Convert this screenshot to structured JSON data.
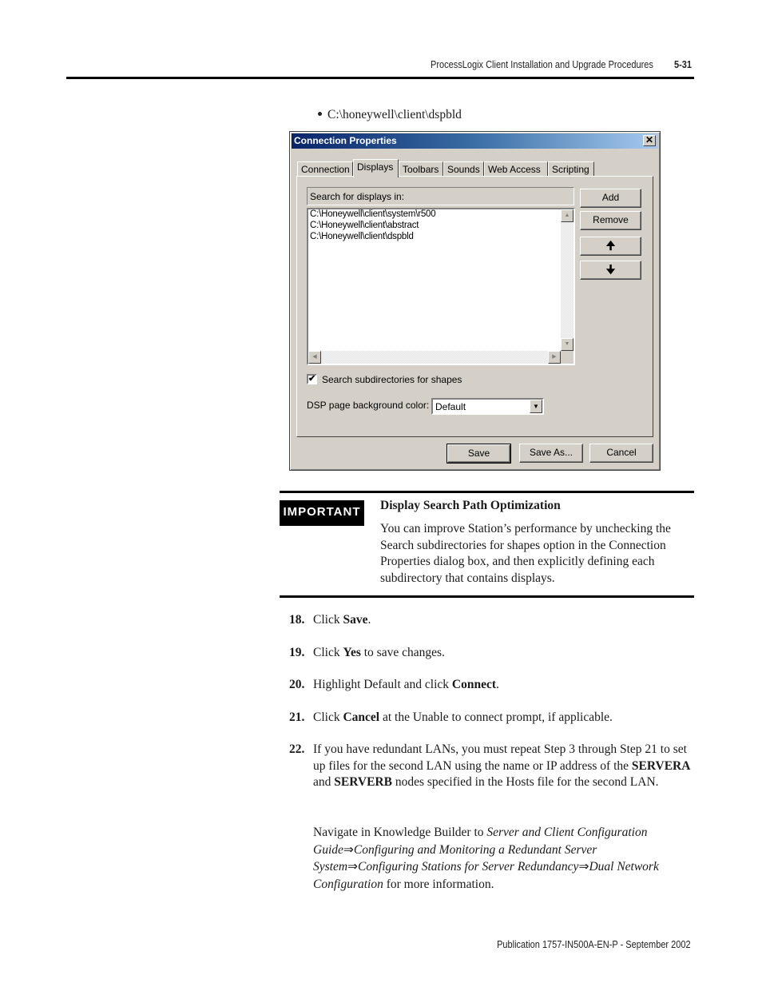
{
  "header": {
    "section_title": "ProcessLogix Client Installation and Upgrade Procedures",
    "page_number": "5-31"
  },
  "bullet": "C:\\honeywell\\client\\dspbld",
  "dialog": {
    "title": "Connection Properties",
    "close_icon": "close-icon",
    "tabs": [
      {
        "label": "Connection",
        "active": false
      },
      {
        "label": "Displays",
        "active": true
      },
      {
        "label": "Toolbars",
        "active": false
      },
      {
        "label": "Sounds",
        "active": false
      },
      {
        "label": "Web Access",
        "active": false
      },
      {
        "label": "Scripting",
        "active": false
      }
    ],
    "list_header": "Search for displays in:",
    "list_items": [
      "C:\\Honeywell\\client\\system\\r500",
      "C:\\Honeywell\\client\\abstract",
      "C:\\Honeywell\\client\\dspbld"
    ],
    "side_buttons": {
      "add": "Add",
      "remove": "Remove",
      "move_up_glyph": "🠉",
      "move_down_glyph": "🠋"
    },
    "checkbox": {
      "label": "Search subdirectories for shapes",
      "checked": true,
      "mark": "✔"
    },
    "bg_color": {
      "label": "DSP page background color:",
      "value": "Default"
    },
    "footer_buttons": {
      "save": "Save",
      "save_as": "Save As...",
      "cancel": "Cancel"
    },
    "scroll_glyphs": {
      "up": "▲",
      "down": "▼",
      "left": "◀",
      "right": "▶",
      "dropdown": "▼"
    }
  },
  "important": {
    "badge": "IMPORTANT",
    "title": "Display Search Path Optimization",
    "body": "You can improve Station’s performance by unchecking the Search subdirectories for shapes option in the Connection Properties dialog box, and then explicitly defining each subdirectory that contains displays."
  },
  "steps": [
    {
      "num": "18.",
      "pre": "Click ",
      "bold": "Save",
      "post": "."
    },
    {
      "num": "19.",
      "pre": "Click ",
      "bold": "Yes",
      "post": " to save changes."
    },
    {
      "num": "20.",
      "pre": "Highlight Default and click ",
      "bold": "Connect",
      "post": "."
    },
    {
      "num": "21.",
      "pre": "Click ",
      "bold": "Cancel",
      "post": " at the Unable to connect prompt, if applicable."
    }
  ],
  "step22": {
    "num": "22.",
    "pre": "If you have redundant LANs, you must repeat Step 3 through Step 21 to set up files for the second LAN using the name or IP address of the ",
    "bold1": "SERVERA",
    "mid": " and ",
    "bold2": "SERVERB",
    "post": " nodes specified in the Hosts file for the second LAN."
  },
  "navigate": {
    "pre": "Navigate in Knowledge Builder to ",
    "path_1": "Server and Client Configuration Guide",
    "arrow": "⇒",
    "path_2": "Configuring and Monitoring a Redundant Server System",
    "path_3": "Configuring Stations for Server Redundancy",
    "path_4": "Dual Network Configuration",
    "post": " for more information."
  },
  "footer": "Publication 1757-IN500A-EN-P - September 2002"
}
